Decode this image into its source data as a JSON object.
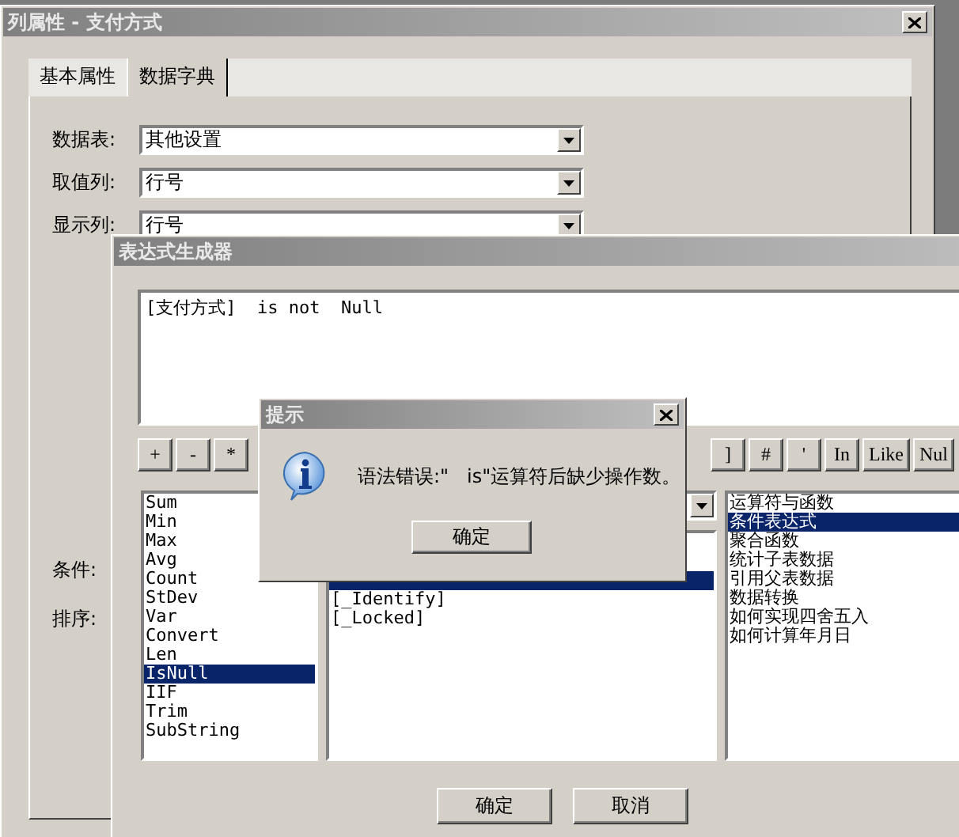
{
  "main_window": {
    "title": "列属性 - 支付方式",
    "tabs": [
      {
        "label": "基本属性",
        "selected": false
      },
      {
        "label": "数据字典",
        "selected": true
      }
    ],
    "fields": [
      {
        "label": "数据表:",
        "value": "其他设置"
      },
      {
        "label": "取值列:",
        "value": "行号"
      },
      {
        "label": "显示列:",
        "value": "行号"
      }
    ],
    "condition_label": "条件:",
    "sort_label": "排序:"
  },
  "expression_builder": {
    "title": "表达式生成器",
    "expression": "[支付方式]  is not  Null",
    "operators_left": [
      "+",
      "-",
      "*"
    ],
    "operators_right": [
      "]",
      "#",
      "'",
      "In",
      "Like",
      "Nul"
    ],
    "functions": [
      {
        "label": "Sum",
        "selected": false
      },
      {
        "label": "Min",
        "selected": false
      },
      {
        "label": "Max",
        "selected": false
      },
      {
        "label": "Avg",
        "selected": false
      },
      {
        "label": "Count",
        "selected": false
      },
      {
        "label": "StDev",
        "selected": false
      },
      {
        "label": "Var",
        "selected": false
      },
      {
        "label": "Convert",
        "selected": false
      },
      {
        "label": "Len",
        "selected": false
      },
      {
        "label": "IsNull",
        "selected": true
      },
      {
        "label": "IIF",
        "selected": false
      },
      {
        "label": "Trim",
        "selected": false
      },
      {
        "label": "SubString",
        "selected": false
      }
    ],
    "columns": [
      {
        "selected": true
      },
      {
        "label": "[_Identify]",
        "selected": false
      },
      {
        "label": "[_Locked]",
        "selected": false
      }
    ],
    "categories": [
      {
        "label": "运算符与函数",
        "selected": false
      },
      {
        "label": "条件表达式",
        "selected": true
      },
      {
        "label": "聚合函数",
        "selected": false
      },
      {
        "label": "统计子表数据",
        "selected": false
      },
      {
        "label": "引用父表数据",
        "selected": false
      },
      {
        "label": "数据转换",
        "selected": false
      },
      {
        "label": "如何实现四舍五入",
        "selected": false
      },
      {
        "label": "如何计算年月日",
        "selected": false
      }
    ],
    "buttons": [
      "确定",
      "取消"
    ]
  },
  "alert": {
    "title": "提示",
    "message": "语法错误:\"   is\"运算符后缺少操作数。",
    "button": "确定"
  }
}
